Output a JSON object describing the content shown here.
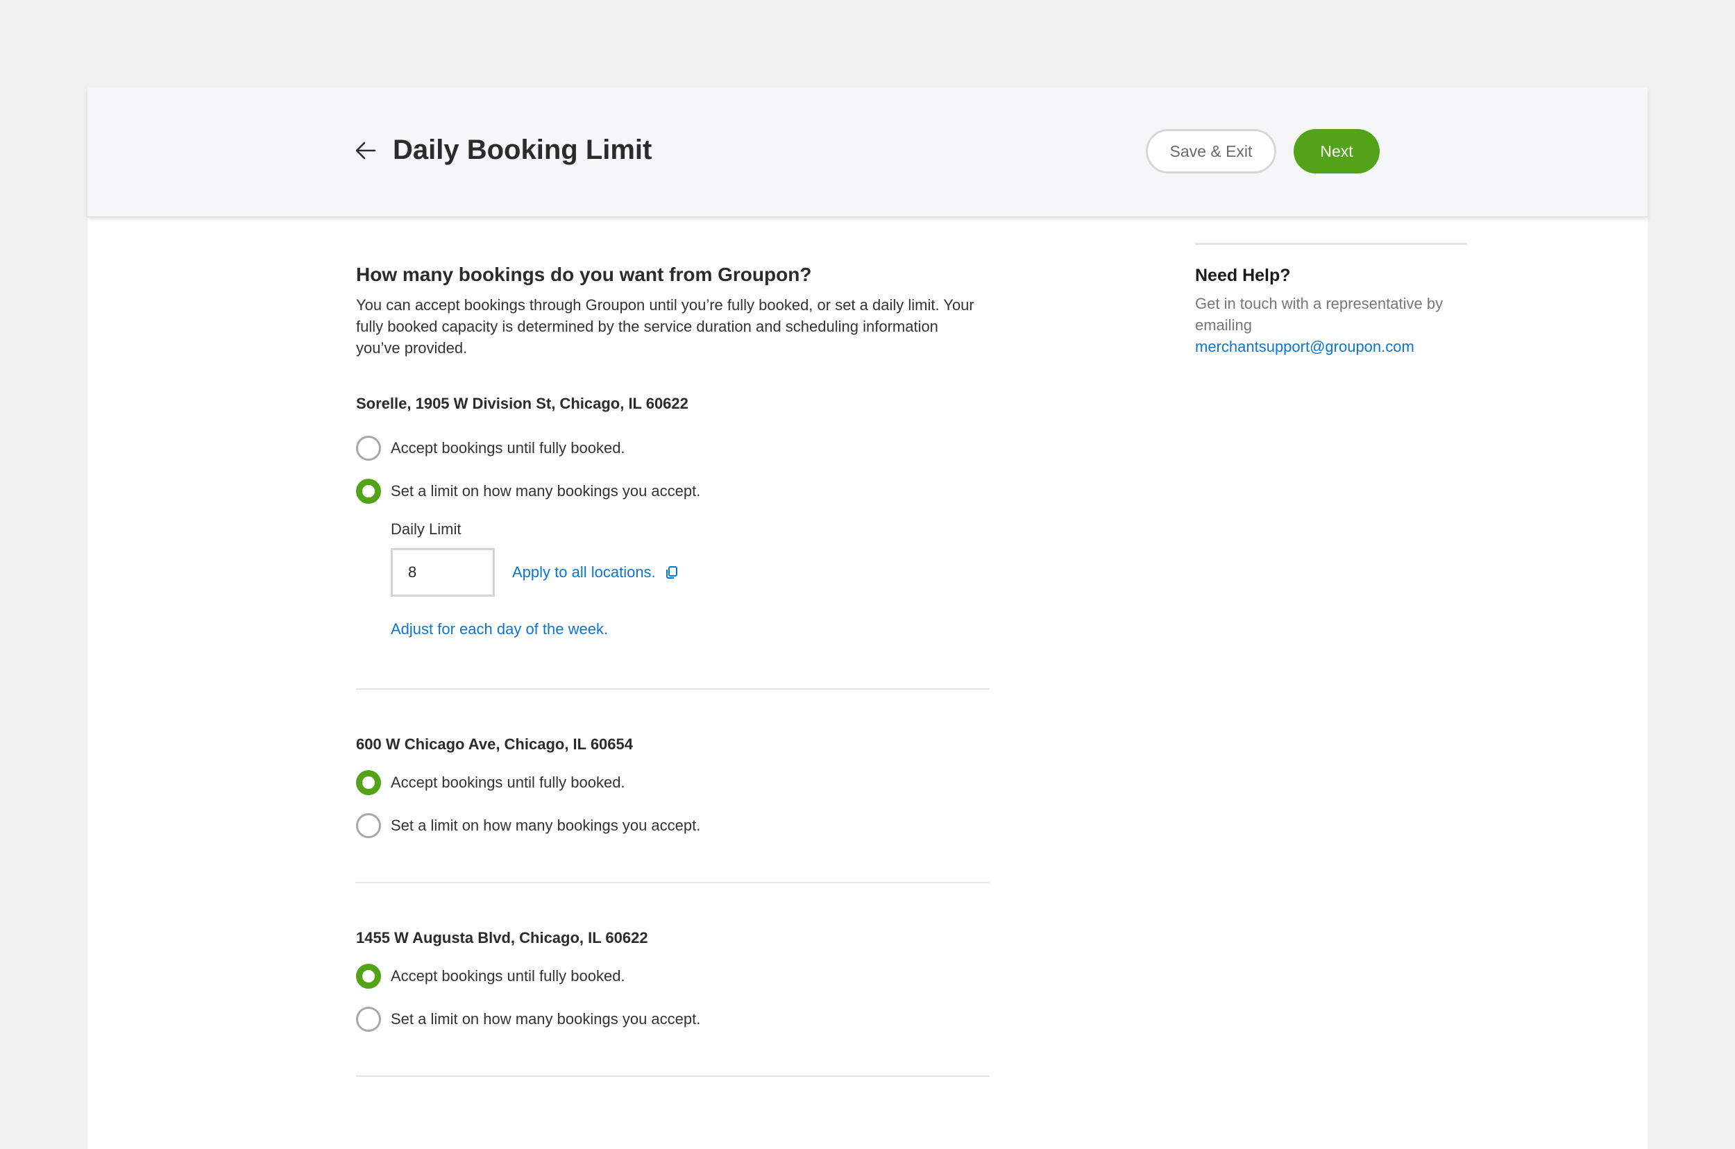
{
  "header": {
    "title": "Daily Booking Limit",
    "save_exit_label": "Save & Exit",
    "next_label": "Next"
  },
  "main": {
    "question": "How many bookings do you want from Groupon?",
    "intro": "You can accept bookings through Groupon until you’re fully booked, or set a daily limit. Your fully booked capacity is determined by the service duration and scheduling information you’ve provided.",
    "locations": [
      {
        "title": "Sorelle, 1905 W Division St, Chicago, IL 60622",
        "option_full": "Accept bookings until fully booked.",
        "option_limit": "Set a limit on how many bookings you accept.",
        "selected": "limit",
        "daily_limit_label": "Daily Limit",
        "daily_limit_value": "8",
        "apply_all_label": "Apply to all locations.",
        "adjust_label": "Adjust for each day of the week."
      },
      {
        "title": "600 W Chicago Ave, Chicago, IL 60654",
        "option_full": "Accept bookings until fully booked.",
        "option_limit": "Set a limit on how many bookings you accept.",
        "selected": "full"
      },
      {
        "title": "1455 W Augusta Blvd, Chicago, IL 60622",
        "option_full": "Accept bookings until fully booked.",
        "option_limit": "Set a limit on how many bookings you accept.",
        "selected": "full"
      }
    ]
  },
  "help": {
    "title": "Need Help?",
    "text": "Get in touch with a representative by emailing",
    "email": "merchantsupport@groupon.com"
  },
  "colors": {
    "accent_green": "#53a318",
    "link_blue": "#0b76cf",
    "page_background": "#f1f1f1",
    "header_background": "#f5f6f7"
  }
}
